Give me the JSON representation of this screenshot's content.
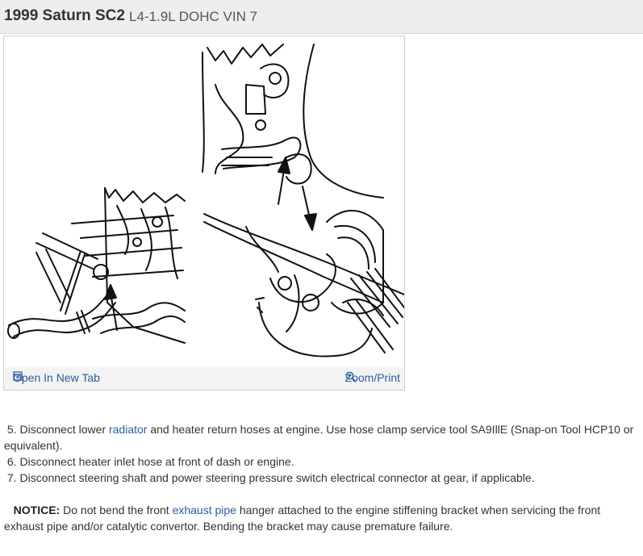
{
  "header": {
    "vehicle": "1999 Saturn SC2",
    "engine": "L4-1.9L DOHC VIN 7"
  },
  "figure": {
    "open_label": "Open In New Tab",
    "zoom_label": "Zoom/Print",
    "open_icon": "external-tab-icon",
    "zoom_icon": "magnifier-icon"
  },
  "steps": {
    "s5_num": "5.",
    "s5_a": "Disconnect lower ",
    "s5_link": "radiator",
    "s5_b": " and heater return hoses at engine. Use hose clamp service tool SA9IllE (Snap-on Tool HCP10 or equivalent).",
    "s6_num": "6.",
    "s6": "Disconnect heater inlet hose at front of dash or engine.",
    "s7_num": "7.",
    "s7": "Disconnect steering shaft and power steering pressure switch electrical connector at gear, if applicable."
  },
  "notice": {
    "label": "NOTICE:",
    "a": " Do not bend the front ",
    "link": "exhaust pipe",
    "b": " hanger attached to the engine stiffening bracket when servicing the front exhaust pipe and/or catalytic convertor. Bending the bracket may cause premature failure."
  },
  "colors": {
    "link": "#2a5d9f",
    "header_bg": "#eeeeee"
  }
}
